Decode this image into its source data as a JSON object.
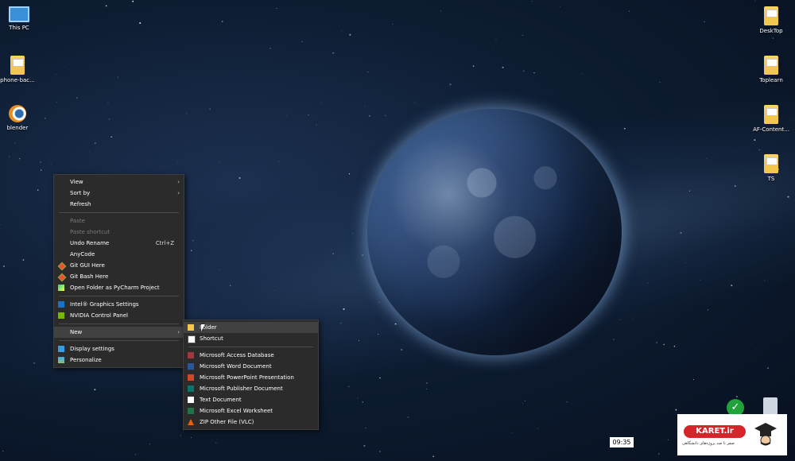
{
  "desktop": {
    "left_icons": [
      {
        "label": "This PC",
        "icon": "pc-icon"
      },
      {
        "label": "phone-bac...",
        "icon": "folder-icon"
      },
      {
        "label": "blender",
        "icon": "blender-icon"
      }
    ],
    "right_icons": [
      {
        "label": "DeskTop",
        "icon": "folder-icon"
      },
      {
        "label": "Toplearn",
        "icon": "folder-icon"
      },
      {
        "label": "AF-Content...",
        "icon": "folder-icon"
      },
      {
        "label": "TS",
        "icon": "folder-icon"
      }
    ]
  },
  "context_menu": {
    "view": "View",
    "sort_by": "Sort by",
    "refresh": "Refresh",
    "paste": "Paste",
    "paste_shortcut": "Paste shortcut",
    "undo_rename": "Undo Rename",
    "undo_shortcut": "Ctrl+Z",
    "anycode": "AnyCode",
    "git_gui": "Git GUI Here",
    "git_bash": "Git Bash Here",
    "pycharm": "Open Folder as PyCharm Project",
    "intel": "Intel® Graphics Settings",
    "nvidia": "NVIDIA Control Panel",
    "new": "New",
    "display": "Display settings",
    "personalize": "Personalize"
  },
  "new_submenu": {
    "folder": "Folder",
    "shortcut": "Shortcut",
    "access": "Microsoft Access Database",
    "word": "Microsoft Word Document",
    "ppt": "Microsoft PowerPoint Presentation",
    "publisher": "Microsoft Publisher Document",
    "text": "Text Document",
    "excel": "Microsoft Excel Worksheet",
    "zip": "ZIP Other File (VLC)"
  },
  "clock": "09:35",
  "watermark": {
    "brand": "KARET.ir",
    "tagline": "صفر تا صد پروژه‌های دانشگاهی"
  }
}
